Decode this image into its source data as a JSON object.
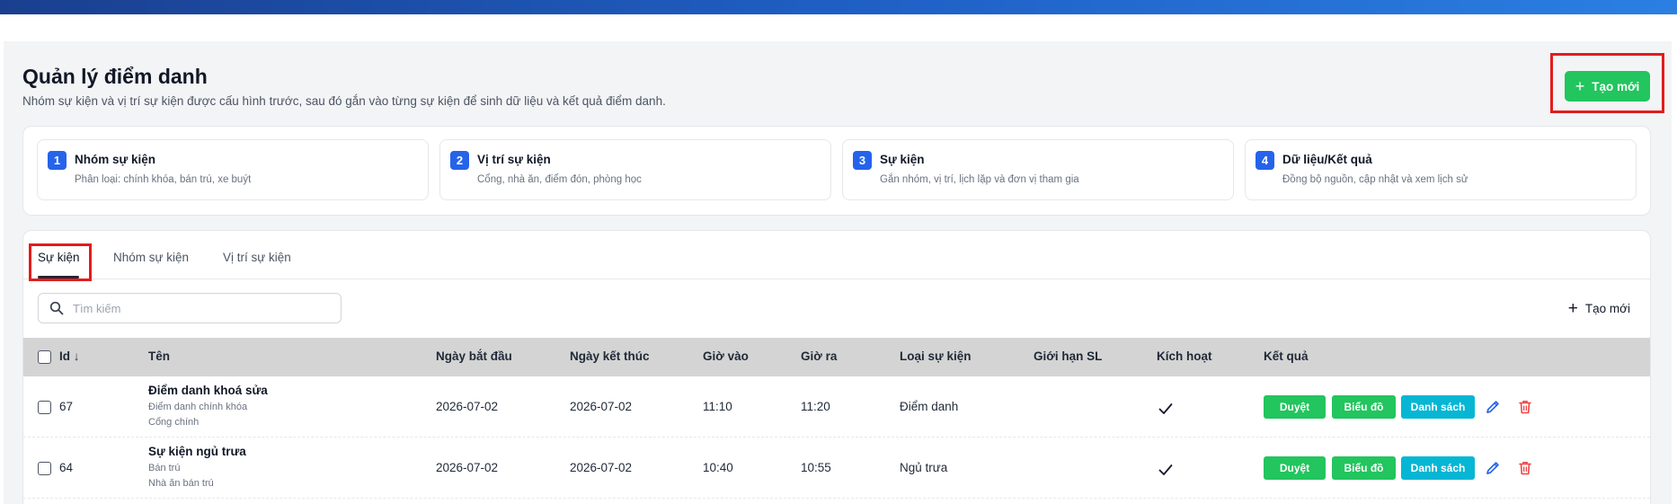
{
  "header": {
    "title": "Quản lý điểm danh",
    "subtitle": "Nhóm sự kiện và vị trí sự kiện được cấu hình trước, sau đó gắn vào từng sự kiện để sinh dữ liệu và kết quả điểm danh.",
    "create_label": "Tạo mới"
  },
  "steps": [
    {
      "num": "1",
      "title": "Nhóm sự kiện",
      "desc": "Phân loại: chính khóa, bán trú, xe buýt"
    },
    {
      "num": "2",
      "title": "Vị trí sự kiện",
      "desc": "Cổng, nhà ăn, điểm đón, phòng học"
    },
    {
      "num": "3",
      "title": "Sự kiện",
      "desc": "Gắn nhóm, vị trí, lịch lặp và đơn vị tham gia"
    },
    {
      "num": "4",
      "title": "Dữ liệu/Kết quả",
      "desc": "Đồng bộ nguồn, cập nhật và xem lịch sử"
    }
  ],
  "tabs": [
    {
      "label": "Sự kiện",
      "active": true
    },
    {
      "label": "Nhóm sự kiện",
      "active": false
    },
    {
      "label": "Vị trí sự kiện",
      "active": false
    }
  ],
  "search": {
    "placeholder": "Tìm kiếm",
    "value": ""
  },
  "toolbar": {
    "create_label": "Tạo mới"
  },
  "table": {
    "columns": [
      "Id ↓",
      "Tên",
      "Ngày bắt đầu",
      "Ngày kết thúc",
      "Giờ vào",
      "Giờ ra",
      "Loại sự kiện",
      "Giới hạn SL",
      "Kích hoạt",
      "Kết quả"
    ],
    "rows": [
      {
        "id": "67",
        "name": "Điểm danh khoá sửa",
        "group": "Điểm danh chính khóa",
        "location": "Cổng chính",
        "start": "2026-07-02",
        "end": "2026-07-02",
        "time_in": "11:10",
        "time_out": "11:20",
        "type": "Điểm danh",
        "limit": "",
        "active": true
      },
      {
        "id": "64",
        "name": "Sự kiện ngủ trưa",
        "group": "Bán trú",
        "location": "Nhà ăn bán trú",
        "start": "2026-07-02",
        "end": "2026-07-02",
        "time_in": "10:40",
        "time_out": "10:55",
        "type": "Ngủ trưa",
        "limit": "",
        "active": true
      }
    ],
    "actions": {
      "approve": "Duyệt",
      "chart": "Biểu đồ",
      "list": "Danh sách"
    }
  },
  "colors": {
    "primary": "#2563eb",
    "success": "#22c55e",
    "info": "#06b6d4",
    "danger": "#ef4444",
    "highlight": "#e11d1d"
  }
}
